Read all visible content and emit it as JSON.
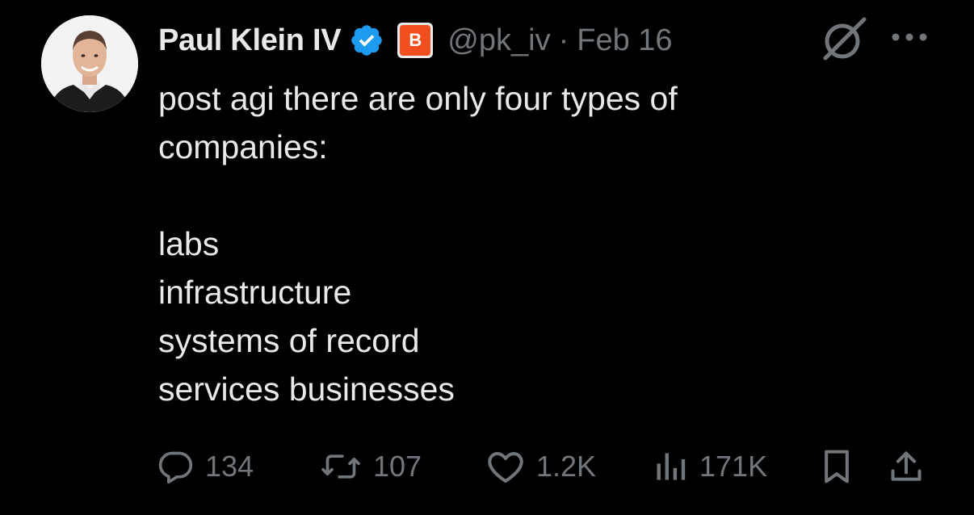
{
  "author": {
    "display_name": "Paul Klein IV",
    "handle": "@pk_iv",
    "separator": "·",
    "date": "Feb 16",
    "verified_icon": "verified-badge-icon",
    "affiliation_badge": "B",
    "affiliation_color": "#f24e1e"
  },
  "tweet": {
    "lines": [
      "post agi there are only four types of",
      "companies:",
      "",
      "labs",
      "infrastructure",
      "systems of record",
      "services businesses"
    ]
  },
  "actions": {
    "replies": "134",
    "reposts": "107",
    "likes": "1.2K",
    "views": "171K"
  },
  "colors": {
    "background": "#000000",
    "text": "#e7e9ea",
    "muted": "#71767b",
    "verified": "#1d9bf0"
  }
}
